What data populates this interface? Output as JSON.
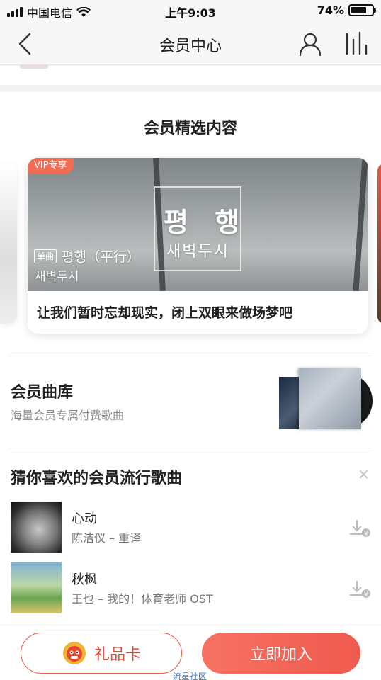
{
  "status_bar": {
    "carrier": "中国电信",
    "time": "上午9:03",
    "battery_percent": "74%",
    "battery_level": 0.74
  },
  "nav": {
    "title": "会员中心",
    "back_icon": "chevron-left-icon",
    "profile_icon": "user-icon",
    "menu_icon": "equalizer-bars-icon"
  },
  "featured": {
    "section_title": "会员精选内容",
    "card": {
      "tag": "VIP专享",
      "art_title": "평 행",
      "art_subtitle": "새벽두시",
      "single_tag": "单曲",
      "song_title": "평행（平行）",
      "artist": "새벽두시",
      "caption": "让我们暂时忘却现实，闭上双眼来做场梦吧"
    }
  },
  "library": {
    "title": "会员曲库",
    "subtitle": "海量会员专属付费歌曲"
  },
  "recommend": {
    "title": "猜你喜欢的会员流行歌曲",
    "close_icon": "close-icon",
    "songs": [
      {
        "name": "心动",
        "meta": "陈洁仪 – 重译",
        "download_icon": "download-icon"
      },
      {
        "name": "秋枫",
        "meta": "王也 – 我的！体育老师 OST",
        "download_icon": "download-icon"
      }
    ]
  },
  "bottom": {
    "gift_label": "礼品卡",
    "join_label": "立即加入",
    "watermark": "流星社区"
  },
  "colors": {
    "accent": "#ef5a4e",
    "vip_tag": "#f26b53"
  }
}
